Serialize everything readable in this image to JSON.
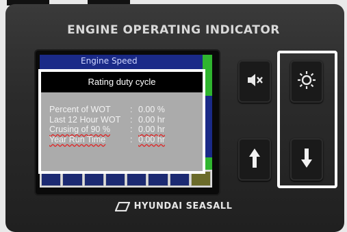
{
  "device": {
    "title": "ENGINE OPERATING INDICATOR",
    "brand": "HYUNDAI SEASALL"
  },
  "screen": {
    "header": "Engine Speed",
    "popup": {
      "title": "Rating duty cycle",
      "rows": [
        {
          "label": "Percent of WOT",
          "sep": ":",
          "value": "0.00 %"
        },
        {
          "label": "Last 12 Hour WOT",
          "sep": ":",
          "value": "0.00 hr"
        },
        {
          "label": "Crusing of 90 %",
          "sep": ":",
          "value": "0.00 hr"
        },
        {
          "label": "Year Run Time",
          "sep": ":",
          "value": "0.00 hr"
        }
      ]
    }
  },
  "buttons": {
    "mute": {
      "icon": "mute-speaker-icon"
    },
    "brightness": {
      "icon": "brightness-icon"
    },
    "up": {
      "icon": "arrow-up-icon"
    },
    "down": {
      "icon": "arrow-down-icon"
    }
  }
}
